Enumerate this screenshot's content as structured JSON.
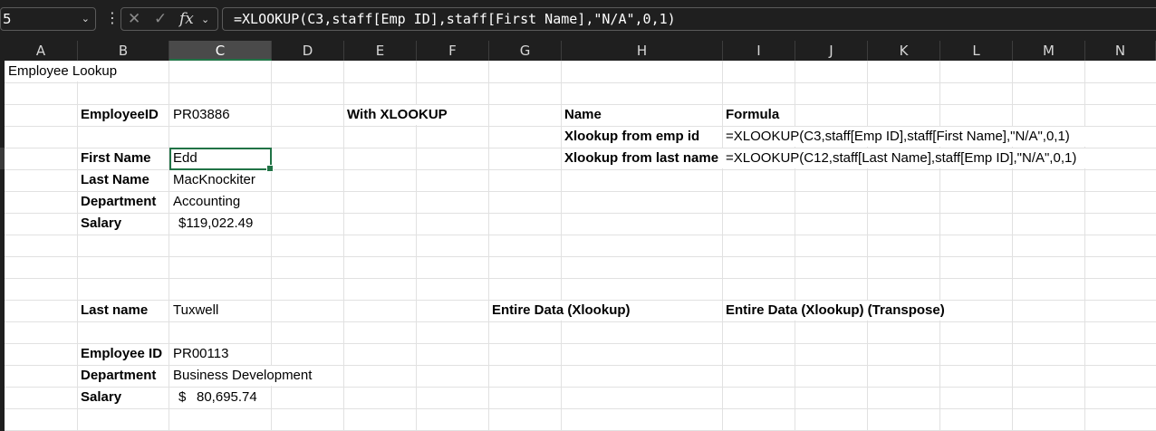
{
  "formula_bar": {
    "name_box": "5",
    "formula": "=XLOOKUP(C3,staff[Emp ID],staff[First Name],\"N/A\",0,1)",
    "cancel_icon": "close-icon",
    "enter_icon": "check-icon",
    "fx_label": "fx"
  },
  "columns": [
    "A",
    "B",
    "C",
    "D",
    "E",
    "F",
    "G",
    "H",
    "I",
    "J",
    "K",
    "L",
    "M",
    "N"
  ],
  "selected_column": "C",
  "cells": {
    "title": "Employee Lookup",
    "employee_id_label": "EmployeeID",
    "employee_id_value": "PR03886",
    "with_xlookup": "With XLOOKUP",
    "name_header": "Name",
    "formula_header": "Formula",
    "xlookup_emp_label": "Xlookup from emp id",
    "xlookup_emp_formula": "=XLOOKUP(C3,staff[Emp ID],staff[First Name],\"N/A\",0,1)",
    "first_name_label": "First Name",
    "first_name_value": "Edd",
    "xlookup_last_label": "Xlookup from last name",
    "xlookup_last_formula": "=XLOOKUP(C12,staff[Last Name],staff[Emp ID],\"N/A\",0,1)",
    "last_name_label": "Last Name",
    "last_name_value": "MacKnockiter",
    "department_label": "Department",
    "department_value": "Accounting",
    "salary_label": "Salary",
    "salary_value": "$119,022.49",
    "last_name2_label": "Last name",
    "last_name2_value": "Tuxwell",
    "entire_data_label": "Entire Data (Xlookup)",
    "entire_data_transpose_label": "Entire Data (Xlookup) (Transpose)",
    "employee_id2_label": "Employee ID",
    "employee_id2_value": "PR00113",
    "department2_label": "Department",
    "department2_value": "Business Development",
    "salary2_label": "Salary",
    "salary2_currency": "$",
    "salary2_amount": "80,695.74"
  }
}
